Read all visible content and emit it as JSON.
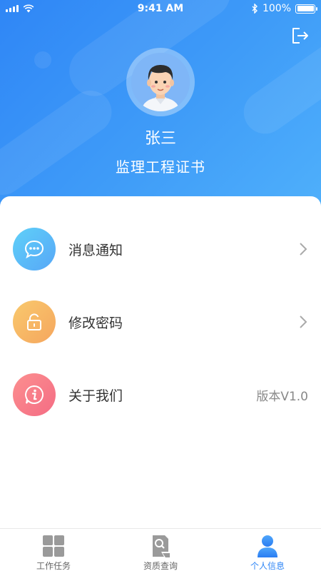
{
  "status_bar": {
    "time": "9:41 AM",
    "battery": "100%"
  },
  "header": {
    "logout_icon": "logout-icon",
    "user_name": "张三",
    "certificate": "监理工程证书"
  },
  "menu": {
    "items": [
      {
        "label": "消息通知",
        "icon": "message-icon",
        "extra": ""
      },
      {
        "label": "修改密码",
        "icon": "lock-icon",
        "extra": ""
      },
      {
        "label": "关于我们",
        "icon": "info-icon",
        "extra": "版本V1.0"
      }
    ]
  },
  "tabbar": {
    "tabs": [
      {
        "label": "工作任务",
        "icon": "grid-icon"
      },
      {
        "label": "资质查询",
        "icon": "document-search-icon"
      },
      {
        "label": "个人信息",
        "icon": "person-icon"
      }
    ],
    "active_tab": "个人信息"
  },
  "colors": {
    "header_gradient_start": "#2f86f6",
    "header_gradient_end": "#4fb0fb",
    "tab_active": "#2f86f6",
    "tab_inactive": "#999999"
  }
}
